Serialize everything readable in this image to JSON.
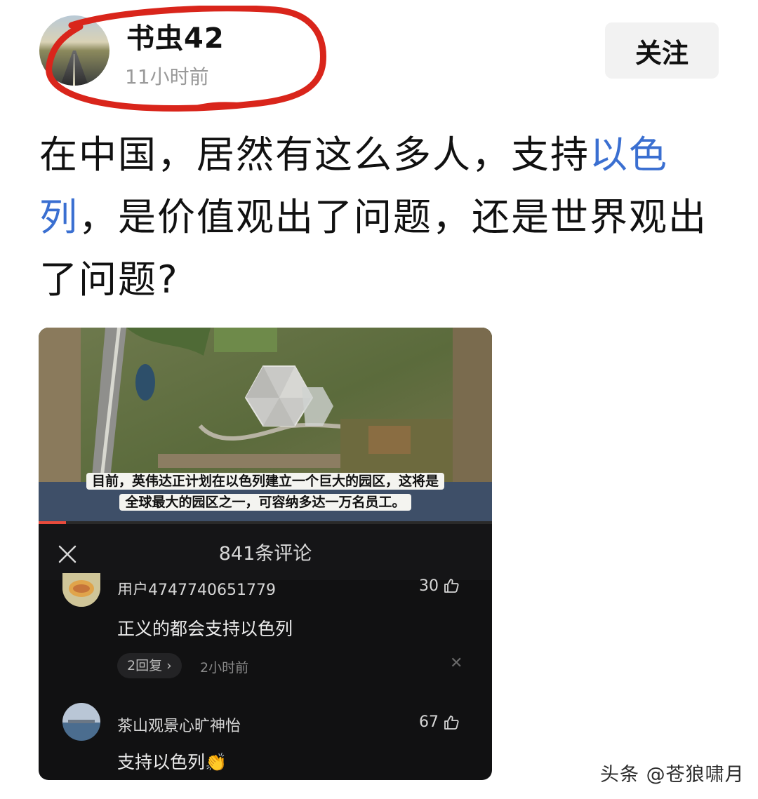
{
  "author": {
    "name": "书虫42",
    "time": "11小时前",
    "follow_label": "关注"
  },
  "post": {
    "segments": [
      {
        "text": "在中国，居然有这么多人，支持",
        "highlight": false
      },
      {
        "text": "以色列",
        "highlight": true
      },
      {
        "text": "，是价值观出了问题，还是世界观出了问题?",
        "highlight": false
      }
    ],
    "highlight_color": "#3a6fd1"
  },
  "embed": {
    "caption_line1": "目前，英伟达正计划在以色列建立一个巨大的园区，这将是",
    "caption_line2": "全球最大的园区之一，可容纳多达一万名员工。",
    "comment_count": "841条评论",
    "comments": [
      {
        "user": "用户4747740651779",
        "text": "正义的都会支持以色列",
        "likes": "30",
        "replies": "2回复 ›",
        "time": "2小时前"
      },
      {
        "user": "茶山观景心旷神怡",
        "text": "支持以色列👏",
        "likes": "67"
      }
    ]
  },
  "watermark": "头条 @苍狼啸月",
  "colors": {
    "annotation_circle": "#d9251b",
    "progress": "#e94b3c"
  }
}
